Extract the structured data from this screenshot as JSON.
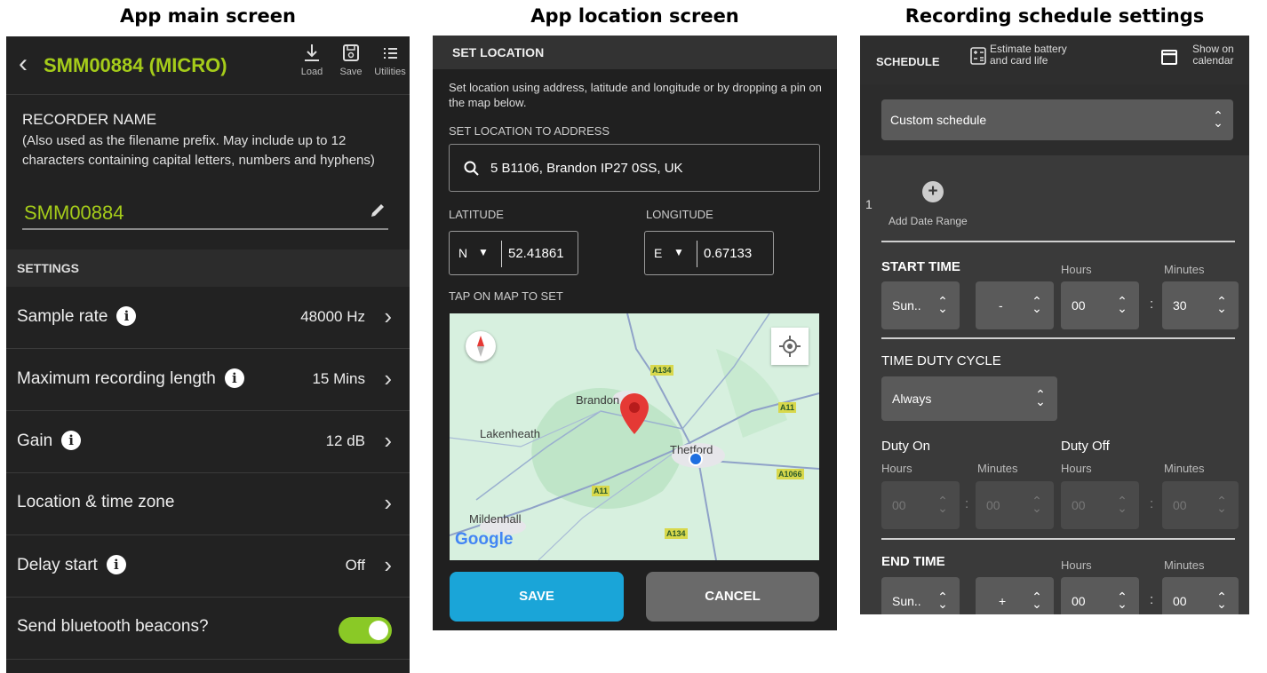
{
  "captions": {
    "main": "App main screen",
    "location": "App location screen",
    "schedule": "Recording schedule settings"
  },
  "main_screen": {
    "title": "SMM00884 (MICRO)",
    "toolbar": {
      "load": "Load",
      "save": "Save",
      "utilities": "Utilities"
    },
    "recorder_name_header": "RECORDER NAME",
    "recorder_name_note": "(Also used as the filename prefix. May include up to 12 characters containing capital letters, numbers and hyphens)",
    "recorder_name_value": "SMM00884",
    "settings_header": "SETTINGS",
    "rows": [
      {
        "label": "Sample rate",
        "value": "48000 Hz"
      },
      {
        "label": "Maximum recording length",
        "value": "15 Mins"
      },
      {
        "label": "Gain",
        "value": "12 dB"
      },
      {
        "label": "Location & time zone",
        "value": ""
      },
      {
        "label": "Delay start",
        "value": "Off"
      },
      {
        "label": "Send bluetooth beacons?",
        "value": ""
      }
    ],
    "bluetooth_on": true,
    "accent_color": "#a5cc1a"
  },
  "location_screen": {
    "header": "SET LOCATION",
    "description": "Set location using address, latitude and longitude or by dropping a pin on the map below.",
    "address_label": "SET LOCATION TO ADDRESS",
    "address_value": "5 B1106, Brandon IP27 0SS, UK",
    "latitude_label": "LATITUDE",
    "longitude_label": "LONGITUDE",
    "lat_hemisphere": "N",
    "lat_value": "52.41861",
    "lon_hemisphere": "E",
    "lon_value": "0.67133",
    "tap_label": "TAP ON MAP TO SET",
    "map": {
      "places": [
        "Brandon",
        "Lakenheath",
        "Thetford",
        "Mildenhall"
      ],
      "roads": [
        "A134",
        "A11",
        "A1066",
        "A11",
        "A134"
      ],
      "attribution": "Google"
    },
    "save": "SAVE",
    "cancel": "CANCEL",
    "save_color": "#1aa5d8"
  },
  "schedule_screen": {
    "header": "SCHEDULE",
    "estimate": [
      "Estimate battery",
      "and card life"
    ],
    "calendar": [
      "Show on",
      "calendar"
    ],
    "schedule_type": "Custom schedule",
    "range_index": "1",
    "add_date_range": "Add Date Range",
    "start_time": {
      "label": "START TIME",
      "hours_label": "Hours",
      "minutes_label": "Minutes",
      "day": "Sun..",
      "offset": "-",
      "hours": "00",
      "minutes": "30"
    },
    "duty_cycle": {
      "label": "TIME DUTY CYCLE",
      "mode": "Always",
      "on_label": "Duty On",
      "off_label": "Duty Off",
      "hours_label": "Hours",
      "minutes_label": "Minutes",
      "on_hours": "00",
      "on_minutes": "00",
      "off_hours": "00",
      "off_minutes": "00"
    },
    "end_time": {
      "label": "END TIME",
      "hours_label": "Hours",
      "minutes_label": "Minutes",
      "day": "Sun..",
      "offset": "+",
      "hours": "00",
      "minutes": "00"
    }
  }
}
